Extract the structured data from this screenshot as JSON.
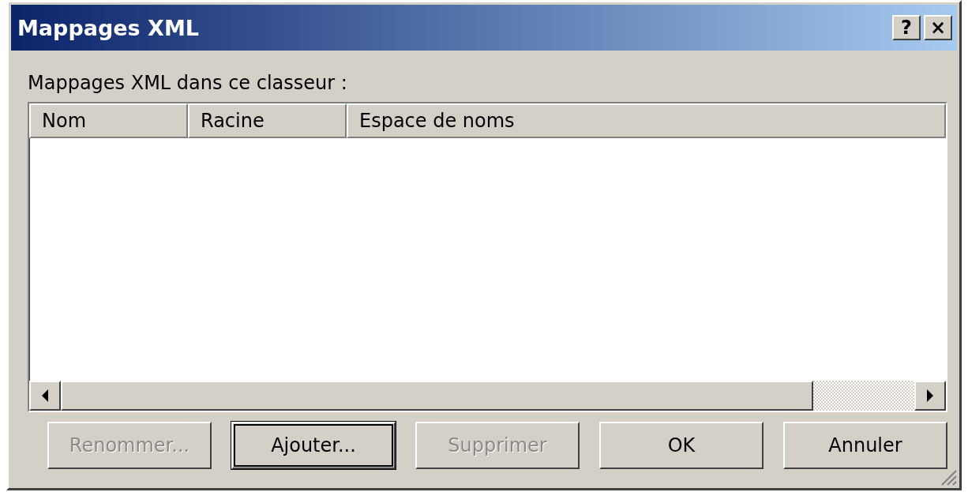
{
  "window": {
    "title": "Mappages XML",
    "controls": [
      {
        "label": "?"
      },
      {
        "label": "×"
      }
    ]
  },
  "list_label": "Mappages XML dans ce classeur :",
  "table": {
    "columns": [
      {
        "label": "Nom"
      },
      {
        "label": "Racine"
      },
      {
        "label": "Espace de noms"
      }
    ]
  },
  "buttons": [
    {
      "label": "Renommer...",
      "disabled": true,
      "focused": false
    },
    {
      "label": "Ajouter...",
      "disabled": false,
      "focused": true
    },
    {
      "label": "Supprimer",
      "disabled": true,
      "focused": false
    },
    {
      "label": "OK",
      "disabled": false,
      "focused": false
    },
    {
      "label": "Annuler",
      "disabled": false,
      "focused": false
    }
  ]
}
